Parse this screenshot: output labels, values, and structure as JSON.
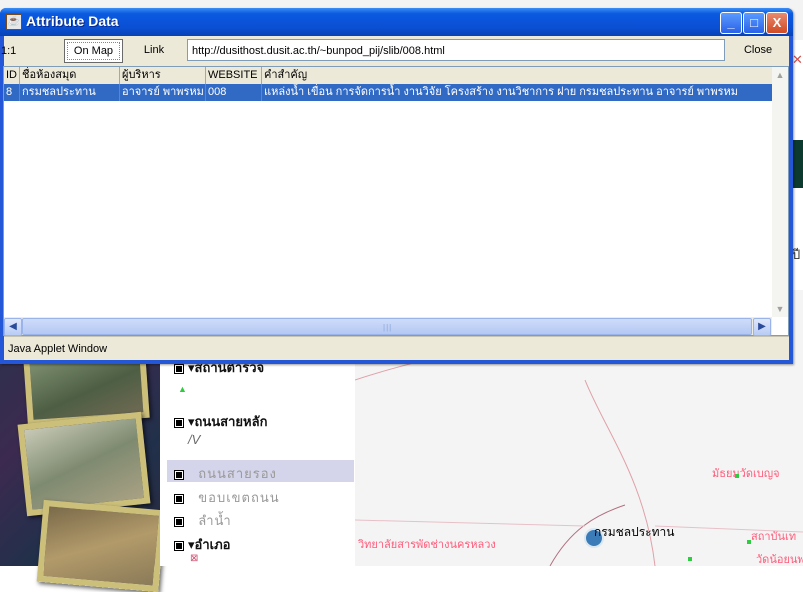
{
  "window": {
    "title": "Attribute Data",
    "status_text": "Java Applet Window",
    "controls": {
      "minimize": "_",
      "maximize": "□",
      "close": "X"
    }
  },
  "toolbar": {
    "scale": "1:1",
    "on_map_label": "On Map",
    "link_label": "Link",
    "url": "http://dusithost.dusit.ac.th/~bunpod_pij/slib/008.html",
    "close_label": "Close"
  },
  "table": {
    "columns": [
      "ID",
      "ชื่อห้องสมุด",
      "ผู้บริหาร",
      "WEBSITE",
      "คำสำคัญ"
    ],
    "rows": [
      {
        "id": "8",
        "library": "กรมชลประทาน",
        "admin": "อาจารย์ พาพรหม",
        "website": "008",
        "keywords": "แหล่งน้ำ เขื่อน การจัดการน้ำ งานวิจัย โครงสร้าง งานวิชาการ ฝาย กรมชลประทาน อาจารย์ พาพรหม"
      }
    ]
  },
  "background": {
    "legend": [
      {
        "label": "สถานีตำรวจ",
        "style": "bold"
      },
      {
        "label": "ถนนสายหลัก",
        "style": "bold"
      },
      {
        "label": "ถนนสายรอง",
        "style": "sub"
      },
      {
        "label": "ขอบเขตถนน",
        "style": "sub"
      },
      {
        "label": "ลำน้ำ",
        "style": "sub"
      },
      {
        "label": "อำเภอ",
        "style": "bold"
      }
    ],
    "map_labels": {
      "irrigation": "กรมชลประทาน",
      "college": "วิทยาลัยสารพัดช่างนครหลวง",
      "temple": "มัธยมวัดเบญจ",
      "airport": "สถาบันเท",
      "temple2": "วัดน้อยนพ"
    },
    "right_edge_text": "ปี"
  }
}
